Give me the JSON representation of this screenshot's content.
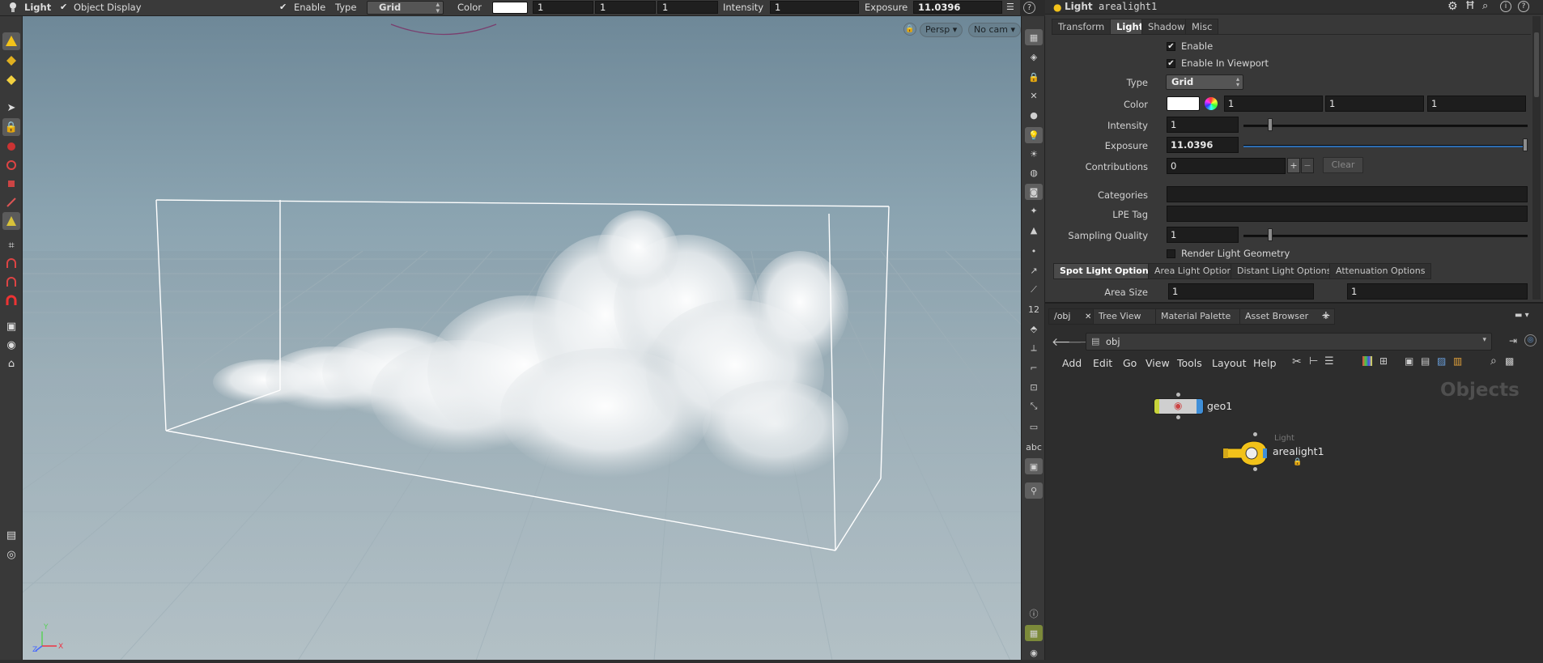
{
  "topbar": {
    "node_type": "Light",
    "object_display": "Object Display",
    "enable_label": "Enable",
    "type_label": "Type",
    "type_value": "Grid",
    "color_label": "Color",
    "color_value": "#ffffff",
    "color_r": "1",
    "color_g": "1",
    "color_b": "1",
    "intensity_label": "Intensity",
    "intensity_value": "1",
    "exposure_label": "Exposure",
    "exposure_value": "11.0396"
  },
  "viewport": {
    "persp_label": "Persp ▾",
    "cam_label": "No cam ▾",
    "axis_y": "Y",
    "axis_z": "Z",
    "axis_x": "X"
  },
  "params": {
    "node_type": "Light",
    "node_name": "arealight1",
    "tabs": [
      "Transform",
      "Light",
      "Shadow",
      "Misc"
    ],
    "enable_label": "Enable",
    "enable_viewport_label": "Enable In Viewport",
    "type_label": "Type",
    "type_value": "Grid",
    "color_label": "Color",
    "color_r": "1",
    "color_g": "1",
    "color_b": "1",
    "intensity_label": "Intensity",
    "intensity_value": "1",
    "exposure_label": "Exposure",
    "exposure_value": "11.0396",
    "contributions_label": "Contributions",
    "contributions_value": "0",
    "clear_label": "Clear",
    "categories_label": "Categories",
    "lpe_label": "LPE Tag",
    "sampling_label": "Sampling Quality",
    "sampling_value": "1",
    "render_geo_label": "Render Light Geometry",
    "subtabs": [
      "Spot Light Options",
      "Area Light Options",
      "Distant Light Options",
      "Attenuation Options"
    ],
    "area_size_label": "Area Size",
    "area_size_x": "1",
    "area_size_y": "1"
  },
  "network": {
    "tabs": [
      "/obj",
      "Tree View",
      "Material Palette",
      "Asset Browser"
    ],
    "path": "obj",
    "menu": [
      "Add",
      "Edit",
      "Go",
      "View",
      "Tools",
      "Layout",
      "Help"
    ],
    "context_title": "Objects",
    "nodes": {
      "geo_name": "geo1",
      "light_type": "Light",
      "light_name": "arealight1"
    }
  },
  "colors": {
    "accent_blue": "#3f8fd8",
    "light_node_yellow": "#f2c21a",
    "viewport_sky": "#7f97a4"
  }
}
